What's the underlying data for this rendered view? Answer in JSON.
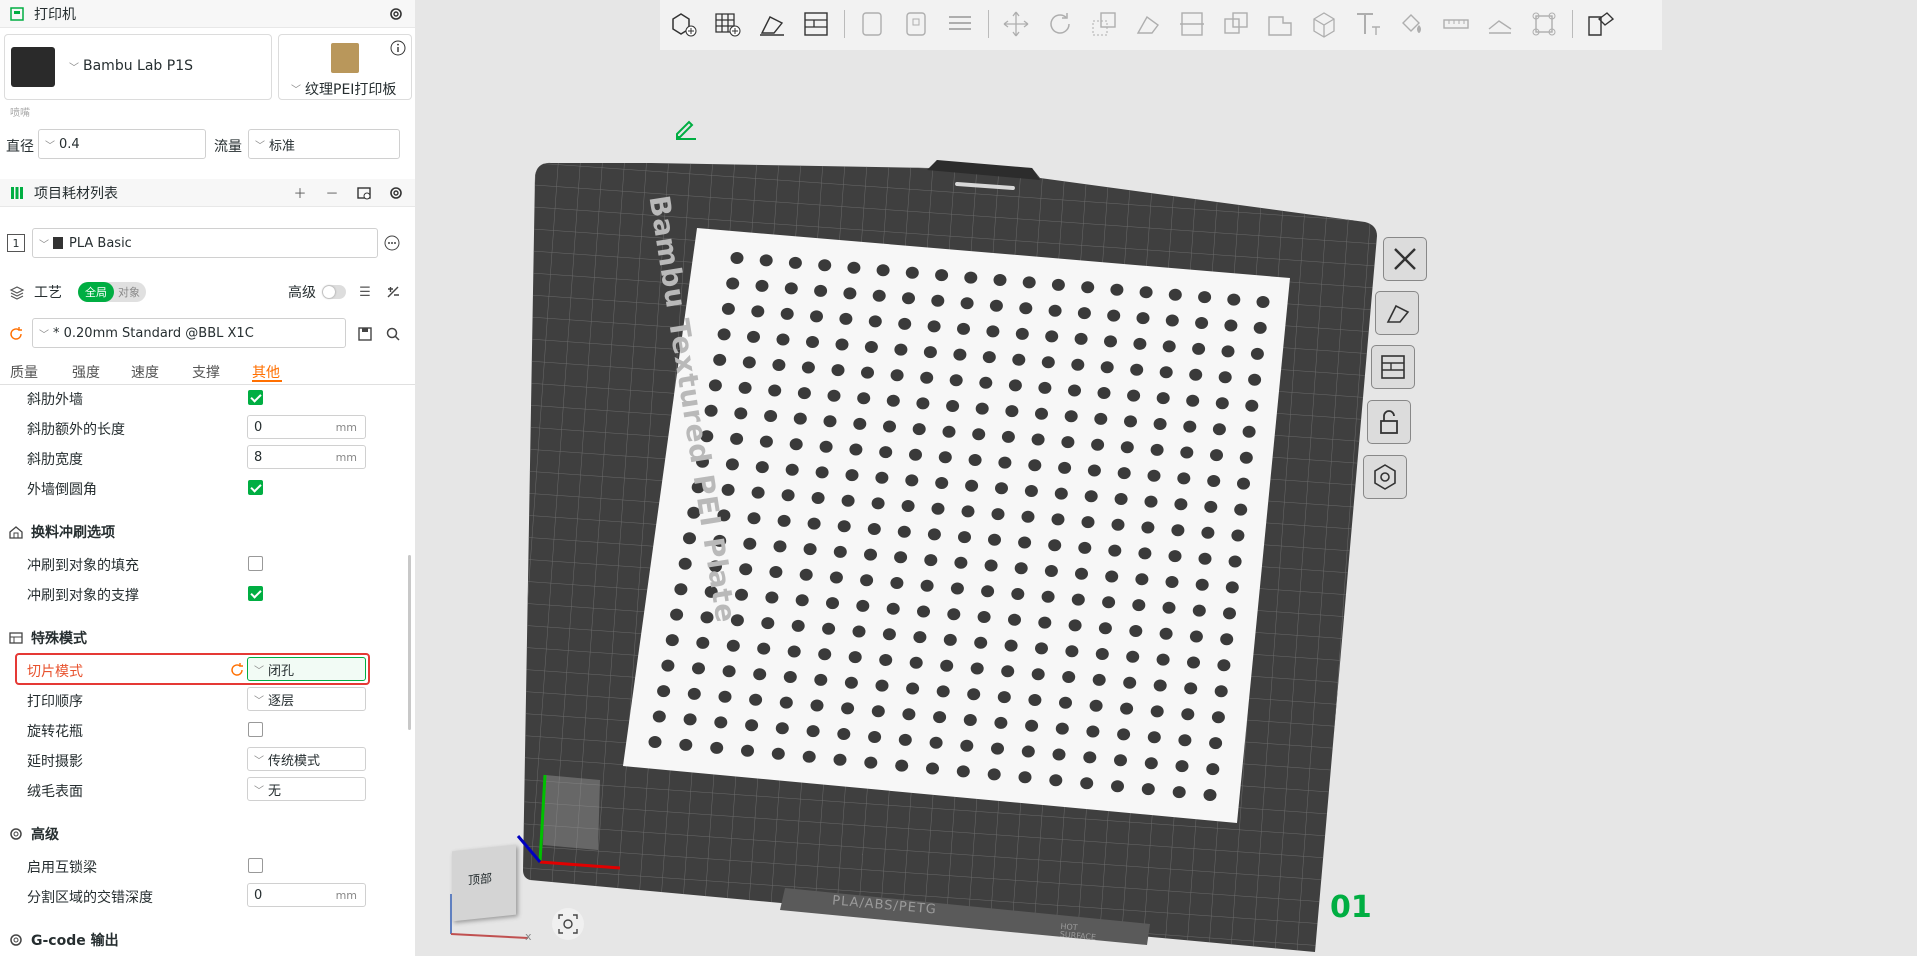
{
  "printer": {
    "section_title": "打印机",
    "model": "Bambu Lab P1S",
    "plate": "纹理PEI打印板",
    "nozzle_label": "喷嘴",
    "diameter_label": "直径",
    "diameter_value": "0.4",
    "flow_label": "流量",
    "flow_value": "标准"
  },
  "filament": {
    "section_title": "项目耗材列表",
    "slot": "1",
    "name": "PLA Basic"
  },
  "process": {
    "section_title": "工艺",
    "toggle_global": "全局",
    "toggle_object": "对象",
    "advanced_label": "高级",
    "preset": "* 0.20mm Standard @BBL X1C",
    "tabs": [
      "质量",
      "强度",
      "速度",
      "支撑",
      "其他"
    ],
    "active_tab": "其他"
  },
  "settings": {
    "rib_wall": {
      "label": "斜肋外墙",
      "checked": true
    },
    "rib_extra_length": {
      "label": "斜肋额外的长度",
      "value": "0",
      "unit": "mm"
    },
    "rib_width": {
      "label": "斜肋宽度",
      "value": "8",
      "unit": "mm"
    },
    "outer_fillet": {
      "label": "外墙倒圆角",
      "checked": true
    },
    "flush_section": "换料冲刷选项",
    "flush_infill": {
      "label": "冲刷到对象的填充",
      "checked": false
    },
    "flush_support": {
      "label": "冲刷到对象的支撑",
      "checked": true
    },
    "special_section": "特殊模式",
    "slice_mode": {
      "label": "切片模式",
      "value": "闭孔"
    },
    "print_order": {
      "label": "打印顺序",
      "value": "逐层"
    },
    "spiral_vase": {
      "label": "旋转花瓶",
      "checked": false
    },
    "timelapse": {
      "label": "延时摄影",
      "value": "传统模式"
    },
    "fuzzy_skin": {
      "label": "绒毛表面",
      "value": "无"
    },
    "advanced_section": "高级",
    "interlocking": {
      "label": "启用互锁梁",
      "checked": false
    },
    "interlock_depth": {
      "label": "分割区域的交错深度",
      "value": "0",
      "unit": "mm"
    },
    "gcode_section": "G-code 输出"
  },
  "viewport": {
    "plate_text": "Bambu Textured PEI Plate",
    "plate_bottom_text": "PLA/ABS/PETG",
    "hot_surface": "HOT SURFACE",
    "plate_number": "01",
    "view_cube_label": "顶部",
    "axis_x": "x",
    "accent_color": "#00ae42",
    "highlight_color": "#e53935",
    "hole_rows": 20,
    "hole_cols": 19
  }
}
